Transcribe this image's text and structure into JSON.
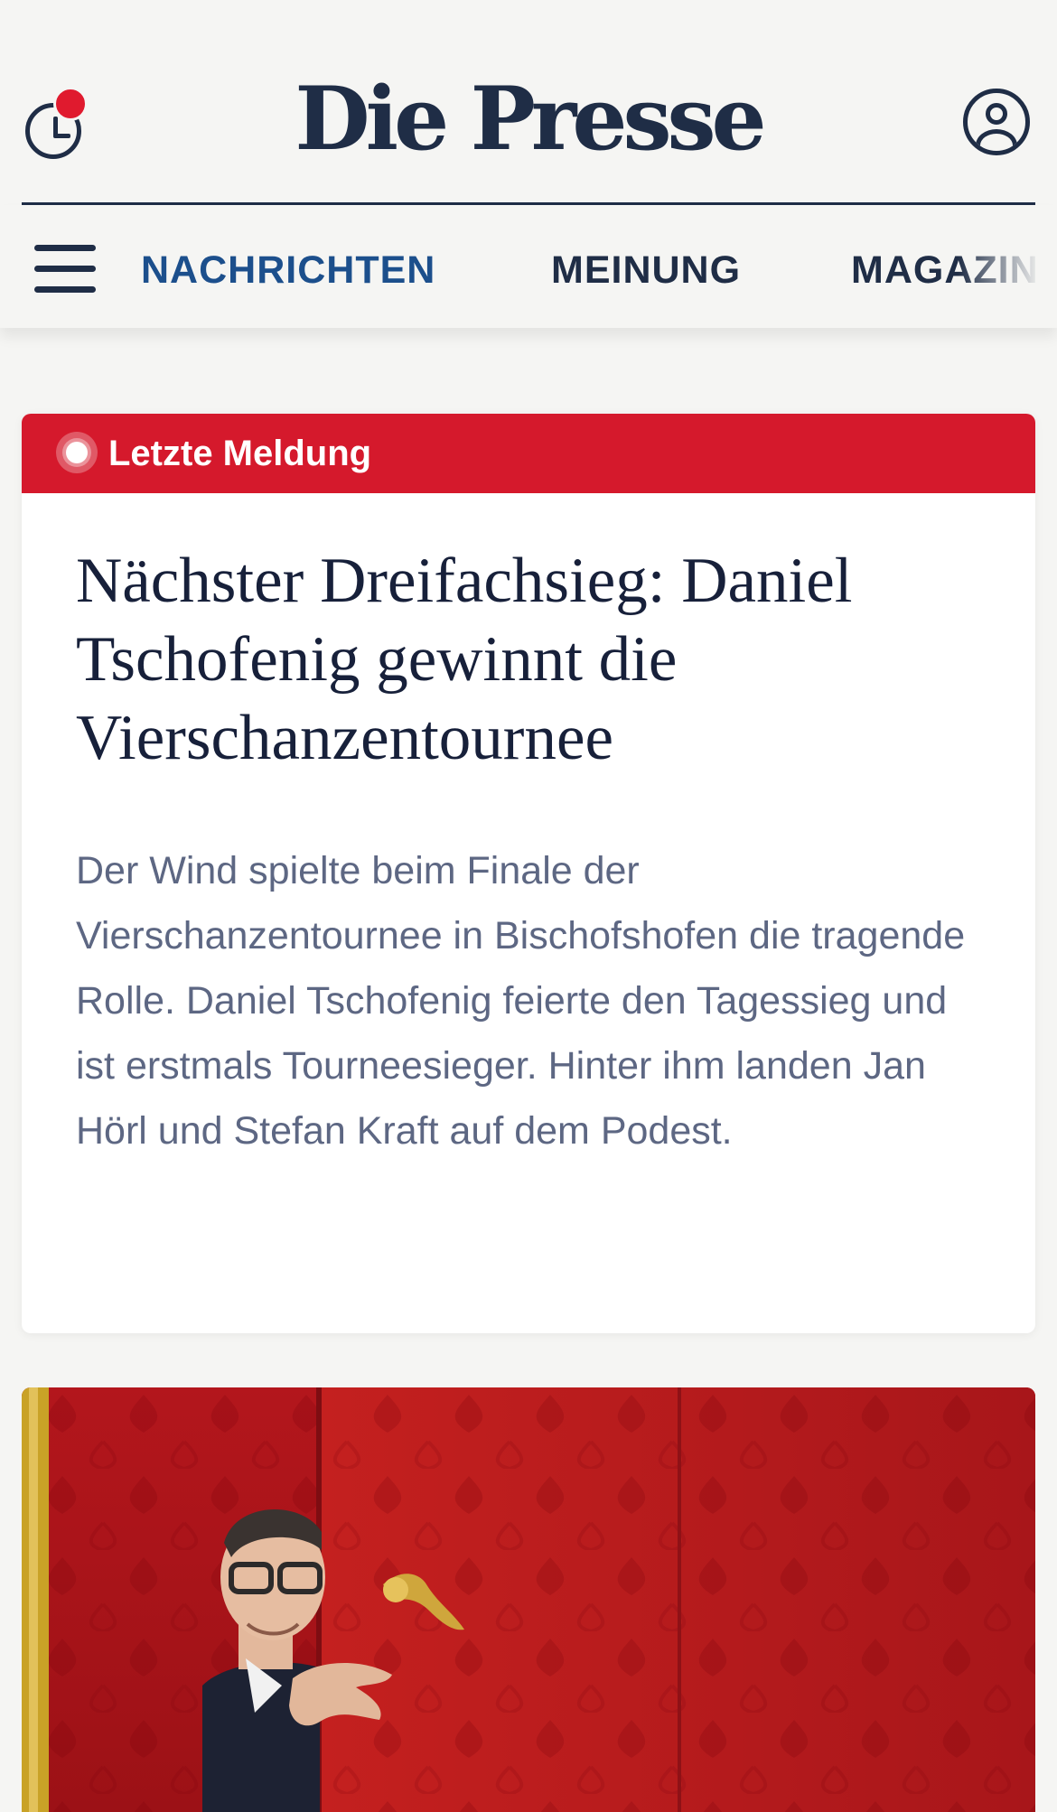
{
  "header": {
    "logo": "Die Presse",
    "history_icon": "clock-icon",
    "account_icon": "user-icon",
    "notification_color": "#e01a2e"
  },
  "nav": {
    "menu_icon": "hamburger-icon",
    "items": [
      {
        "label": "NACHRICHTEN",
        "active": true
      },
      {
        "label": "MEINUNG",
        "active": false
      },
      {
        "label": "MAGAZIN",
        "active": false
      }
    ]
  },
  "breaking": {
    "label": "Letzte Meldung",
    "accent_color": "#d5192c",
    "headline": "Nächster Dreifachsieg: Daniel Tschofenig gewinnt die Vierschanzentournee",
    "teaser": "Der Wind spielte beim Finale der Vierschanzentournee in Bischofshofen die tragende Rolle. Daniel Tschofenig feierte den Tagessieg und ist erstmals Tourneesieger. Hinter ihm landen Jan Hörl und Stefan Kraft auf dem Podest."
  },
  "photo": {
    "icon": "article-photo"
  }
}
